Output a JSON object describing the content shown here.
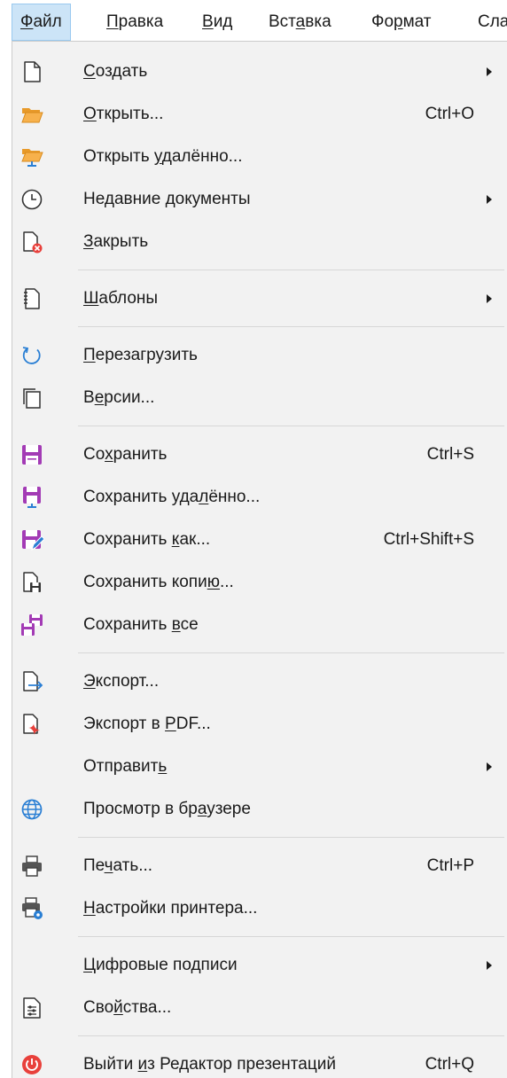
{
  "menubar": {
    "items": [
      {
        "pre": "",
        "u": "Ф",
        "post": "айл",
        "active": true
      },
      {
        "pre": "",
        "u": "П",
        "post": "равка",
        "active": false
      },
      {
        "pre": "",
        "u": "В",
        "post": "ид",
        "active": false
      },
      {
        "pre": "Вст",
        "u": "а",
        "post": "вка",
        "active": false
      },
      {
        "pre": "Фо",
        "u": "р",
        "post": "мат",
        "active": false
      },
      {
        "pre": "Сла",
        "u": "",
        "post": "",
        "active": false
      }
    ]
  },
  "file_menu": {
    "entries": [
      {
        "type": "item",
        "id": "new",
        "icon": "document-icon",
        "pre": "",
        "u": "С",
        "post": "оздать",
        "shortcut": "",
        "submenu": true
      },
      {
        "type": "item",
        "id": "open",
        "icon": "folder-open-icon",
        "pre": "",
        "u": "О",
        "post": "ткрыть...",
        "shortcut": "Ctrl+O",
        "submenu": false
      },
      {
        "type": "item",
        "id": "open-remote",
        "icon": "folder-remote-icon",
        "pre": "Открыть ",
        "u": "у",
        "post": "далённо...",
        "shortcut": "",
        "submenu": false
      },
      {
        "type": "item",
        "id": "recent-documents",
        "icon": "clock-icon",
        "pre": "Недавние ",
        "u": "д",
        "post": "окументы",
        "shortcut": "",
        "submenu": true
      },
      {
        "type": "item",
        "id": "close",
        "icon": "close-document-icon",
        "pre": "",
        "u": "З",
        "post": "акрыть",
        "shortcut": "",
        "submenu": false
      },
      {
        "type": "separator"
      },
      {
        "type": "item",
        "id": "templates",
        "icon": "templates-icon",
        "pre": "",
        "u": "Ш",
        "post": "аблоны",
        "shortcut": "",
        "submenu": true
      },
      {
        "type": "separator"
      },
      {
        "type": "item",
        "id": "reload",
        "icon": "reload-icon",
        "pre": "",
        "u": "П",
        "post": "ерезагрузить",
        "shortcut": "",
        "submenu": false
      },
      {
        "type": "item",
        "id": "versions",
        "icon": "versions-icon",
        "pre": "В",
        "u": "е",
        "post": "рсии...",
        "shortcut": "",
        "submenu": false
      },
      {
        "type": "separator"
      },
      {
        "type": "item",
        "id": "save",
        "icon": "save-icon",
        "pre": "Со",
        "u": "х",
        "post": "ранить",
        "shortcut": "Ctrl+S",
        "submenu": false
      },
      {
        "type": "item",
        "id": "save-remote",
        "icon": "save-remote-icon",
        "pre": "Сохранить уда",
        "u": "л",
        "post": "ённо...",
        "shortcut": "",
        "submenu": false
      },
      {
        "type": "item",
        "id": "save-as",
        "icon": "save-as-icon",
        "pre": "Сохранить ",
        "u": "к",
        "post": "ак...",
        "shortcut": "Ctrl+Shift+S",
        "submenu": false
      },
      {
        "type": "item",
        "id": "save-copy",
        "icon": "save-copy-icon",
        "pre": "Сохранить копи",
        "u": "ю",
        "post": "...",
        "shortcut": "",
        "submenu": false
      },
      {
        "type": "item",
        "id": "save-all",
        "icon": "save-all-icon",
        "pre": "Сохранить ",
        "u": "в",
        "post": "се",
        "shortcut": "",
        "submenu": false
      },
      {
        "type": "separator"
      },
      {
        "type": "item",
        "id": "export",
        "icon": "export-icon",
        "pre": "",
        "u": "Э",
        "post": "кспорт...",
        "shortcut": "",
        "submenu": false
      },
      {
        "type": "item",
        "id": "export-pdf",
        "icon": "export-pdf-icon",
        "pre": "Экспорт в ",
        "u": "P",
        "post": "DF...",
        "shortcut": "",
        "submenu": false
      },
      {
        "type": "item",
        "id": "send",
        "icon": "",
        "pre": "Отправит",
        "u": "ь",
        "post": "",
        "shortcut": "",
        "submenu": true
      },
      {
        "type": "item",
        "id": "preview-browser",
        "icon": "globe-icon",
        "pre": "Просмотр в бр",
        "u": "а",
        "post": "узере",
        "shortcut": "",
        "submenu": false
      },
      {
        "type": "separator"
      },
      {
        "type": "item",
        "id": "print",
        "icon": "printer-icon",
        "pre": "Пе",
        "u": "ч",
        "post": "ать...",
        "shortcut": "Ctrl+P",
        "submenu": false
      },
      {
        "type": "item",
        "id": "printer-settings",
        "icon": "printer-settings-icon",
        "pre": "",
        "u": "Н",
        "post": "астройки принтера...",
        "shortcut": "",
        "submenu": false
      },
      {
        "type": "separator"
      },
      {
        "type": "item",
        "id": "digital-signatures",
        "icon": "",
        "pre": "",
        "u": "Ц",
        "post": "ифровые подписи",
        "shortcut": "",
        "submenu": true
      },
      {
        "type": "item",
        "id": "properties",
        "icon": "properties-icon",
        "pre": "Сво",
        "u": "й",
        "post": "ства...",
        "shortcut": "",
        "submenu": false
      },
      {
        "type": "separator"
      },
      {
        "type": "item",
        "id": "exit",
        "icon": "power-icon",
        "pre": "Выйти ",
        "u": "и",
        "post": "з Редактор презентаций",
        "shortcut": "Ctrl+Q",
        "submenu": false
      }
    ]
  },
  "colors": {
    "menubar_active_bg": "#cce4f7",
    "menu_bg": "#f2f2f2",
    "save_purple": "#a33bb5",
    "folder_orange": "#f5a623",
    "accent_blue": "#2a7fd4",
    "exit_red": "#e8403b"
  }
}
